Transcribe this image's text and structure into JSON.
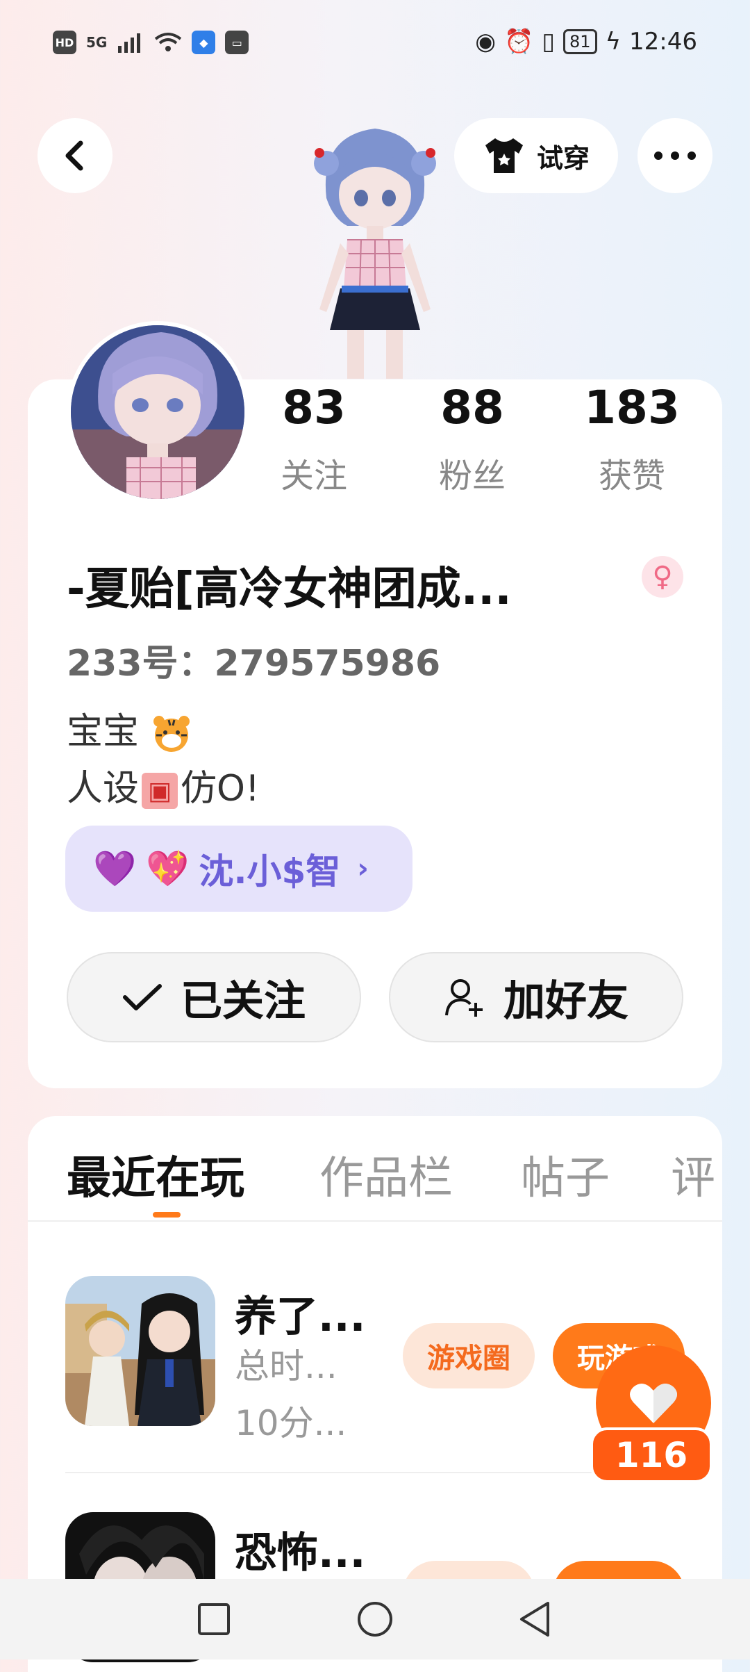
{
  "status_bar": {
    "hd": "HD",
    "network": "5G",
    "battery": "81",
    "time": "12:46"
  },
  "header": {
    "back_icon": "chevron-left-icon",
    "try_on_label": "试穿",
    "more_icon": "more-dots-icon"
  },
  "profile": {
    "stats": [
      {
        "value": "83",
        "label": "关注"
      },
      {
        "value": "88",
        "label": "粉丝"
      },
      {
        "value": "183",
        "label": "获赞"
      }
    ],
    "nickname": "-夏贻[高冷女神团成...",
    "gender_icon": "female-icon",
    "uid": "233号：279575986",
    "bio_line1": "宝宝",
    "bio_line2_a": "人设",
    "bio_line2_b": "仿O!",
    "cp_name": "沈.小$智",
    "following_label": "已关注",
    "add_friend_label": "加好友"
  },
  "tabs": [
    "最近在玩",
    "作品栏",
    "帖子",
    "评"
  ],
  "games": [
    {
      "title": "养了...",
      "meta1": "总时...",
      "meta2": "10分...",
      "tag_circle": "游戏圈",
      "tag_play": "玩游戏"
    },
    {
      "title": "恐怖...",
      "meta1": "",
      "meta2": "",
      "tag_circle": "",
      "tag_play": ""
    }
  ],
  "like_fab": {
    "count": "116"
  },
  "colors": {
    "accent": "#ff7a1a",
    "cp_tag_bg": "#e6e3fb",
    "cp_tag_text": "#6b5fd8"
  }
}
